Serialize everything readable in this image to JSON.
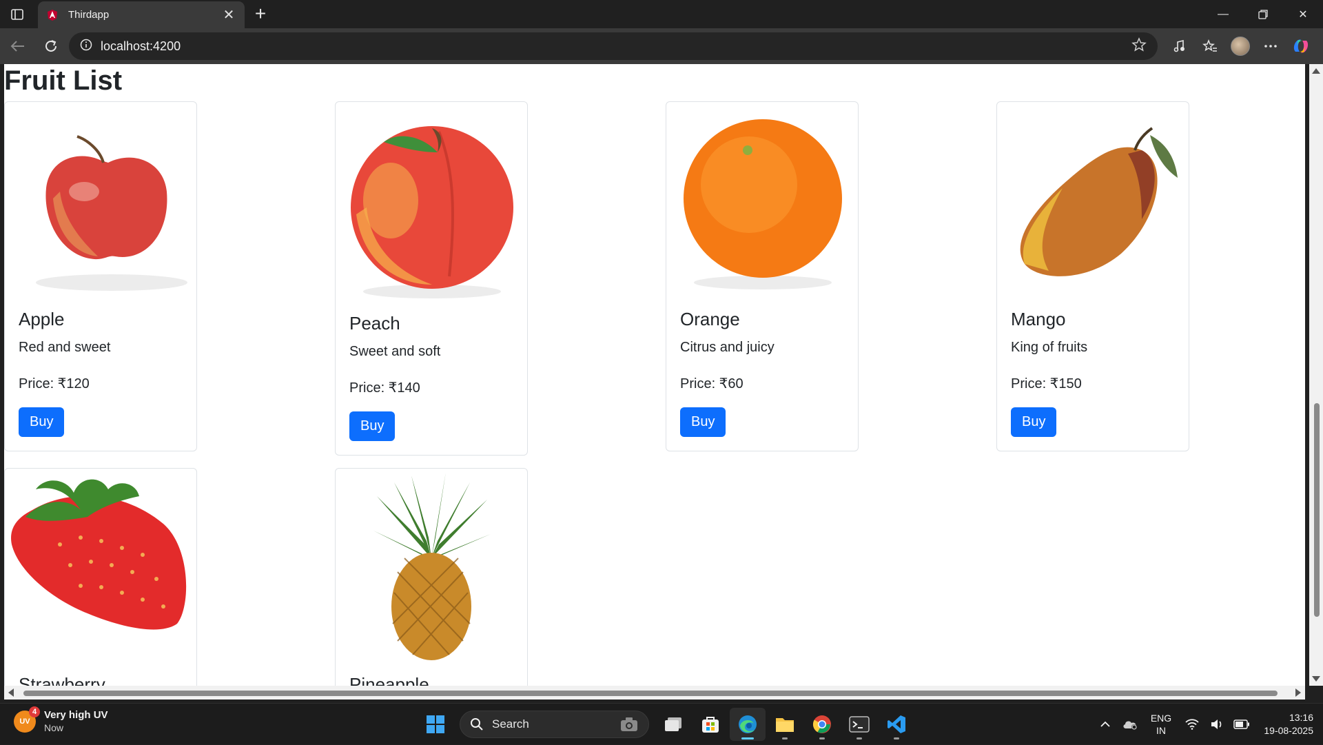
{
  "browser": {
    "tab_title": "Thirdapp",
    "address_url": "localhost:4200"
  },
  "page": {
    "title": "Fruit List",
    "fruits": [
      {
        "name": "Apple",
        "desc": "Red and sweet",
        "price": "Price: ₹120",
        "buy": "Buy"
      },
      {
        "name": "Peach",
        "desc": "Sweet and soft",
        "price": "Price: ₹140",
        "buy": "Buy"
      },
      {
        "name": "Orange",
        "desc": "Citrus and juicy",
        "price": "Price: ₹60",
        "buy": "Buy"
      },
      {
        "name": "Mango",
        "desc": "King of fruits",
        "price": "Price: ₹150",
        "buy": "Buy"
      },
      {
        "name": "Strawberry"
      },
      {
        "name": "Pineapple"
      }
    ]
  },
  "taskbar": {
    "weather_title": "Very high UV",
    "weather_sub": "Now",
    "weather_badge": "4",
    "weather_abbr": "UV",
    "search_label": "Search",
    "lang_line1": "ENG",
    "lang_line2": "IN",
    "time": "13:16",
    "date": "19-08-2025"
  },
  "colors": {
    "accent": "#0d6efd",
    "chrome_bg": "#202020",
    "toolbar_bg": "#3a3a3a"
  }
}
